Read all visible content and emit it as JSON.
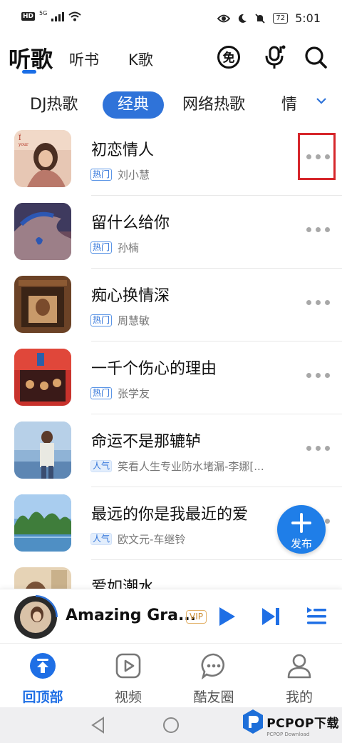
{
  "status_bar": {
    "network": "HD",
    "network_gen": "5G",
    "battery": "72",
    "time": "5:01"
  },
  "top_nav": {
    "tabs": [
      {
        "label": "听歌",
        "active": true
      },
      {
        "label": "听书",
        "active": false
      },
      {
        "label": "K歌",
        "active": false
      }
    ],
    "icons": [
      "free-icon",
      "mic-icon",
      "search-icon"
    ],
    "free_badge_text": "免"
  },
  "genres": {
    "items": [
      "DJ热歌",
      "经典",
      "网络热歌",
      "情"
    ],
    "active": "经典"
  },
  "songs": [
    {
      "title": "初恋情人",
      "badge": "热门",
      "artist": "刘小慧",
      "highlighted": true
    },
    {
      "title": "留什么给你",
      "badge": "热门",
      "artist": "孙楠",
      "highlighted": false
    },
    {
      "title": "痴心换情深",
      "badge": "热门",
      "artist": "周慧敏",
      "highlighted": false
    },
    {
      "title": "一千个伤心的理由",
      "badge": "热门",
      "artist": "张学友",
      "highlighted": false
    },
    {
      "title": "命运不是那辘轳",
      "badge": "人气",
      "artist": "笑看人生专业防水堵漏-李娜[...",
      "highlighted": false
    },
    {
      "title": "最远的你是我最近的爱",
      "badge": "人气",
      "artist": "欧文元-车继铃",
      "highlighted": false
    },
    {
      "title": "爱如潮水",
      "badge": "",
      "artist": "",
      "highlighted": false
    }
  ],
  "fab": {
    "label": "发布"
  },
  "player": {
    "title": "Amazing Gra...",
    "vip": "VIP"
  },
  "bottom_nav": [
    {
      "label": "回顶部",
      "active": true
    },
    {
      "label": "视频",
      "active": false
    },
    {
      "label": "酷友圈",
      "active": false
    },
    {
      "label": "我的",
      "active": false
    }
  ],
  "watermark": {
    "text": "PCPOP下载",
    "sub": "PCPOP Download"
  },
  "colors": {
    "accent": "#2f73d9",
    "highlight_box": "#d6262b",
    "fab": "#1f7ee8"
  }
}
